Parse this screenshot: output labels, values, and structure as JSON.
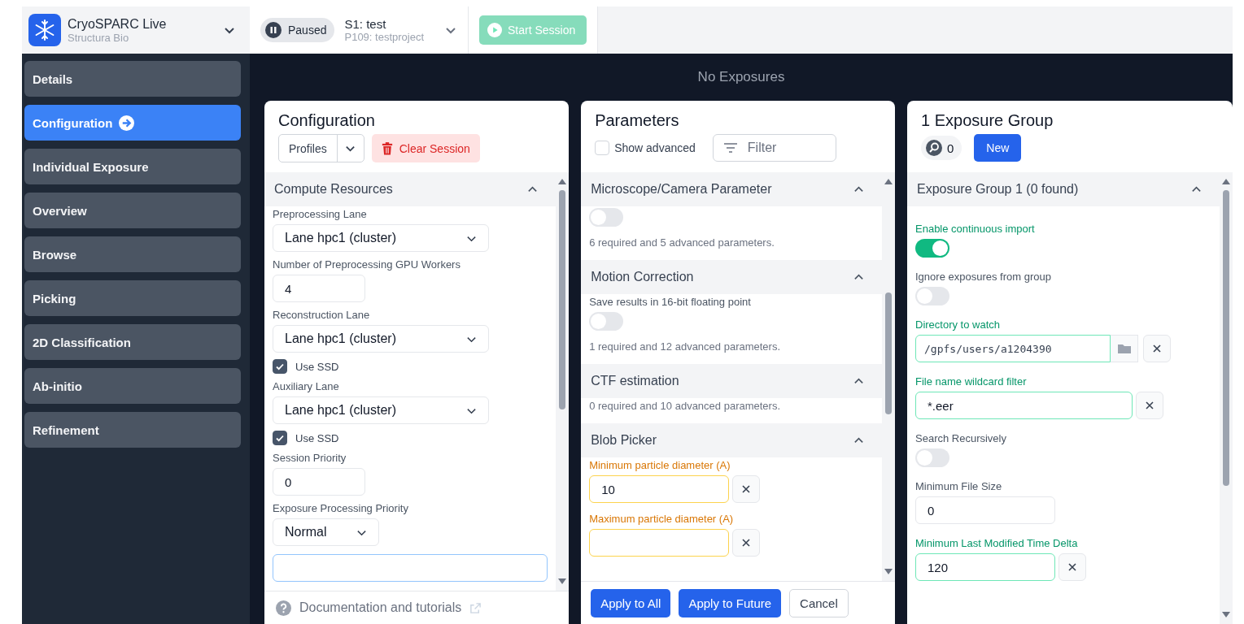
{
  "header": {
    "app_name": "CryoSPARC Live",
    "org": "Structura Bio",
    "status": "Paused",
    "session": "S1: test",
    "project": "P109: testproject",
    "start_button": {
      "label": "Start Session",
      "disabled": true
    }
  },
  "sidebar": {
    "items": [
      {
        "label": "Details",
        "selected": false
      },
      {
        "label": "Configuration",
        "selected": true
      },
      {
        "label": "Individual Exposure",
        "selected": false
      },
      {
        "label": "Overview",
        "selected": false
      },
      {
        "label": "Browse",
        "selected": false
      },
      {
        "label": "Picking",
        "selected": false
      },
      {
        "label": "2D Classification",
        "selected": false
      },
      {
        "label": "Ab-initio",
        "selected": false
      },
      {
        "label": "Refinement",
        "selected": false
      }
    ]
  },
  "banner": "No Exposures",
  "configuration": {
    "title": "Configuration",
    "profiles_button": "Profiles",
    "clear_button": "Clear Session",
    "section": {
      "title": "Compute Resources",
      "expanded": true,
      "fields": [
        {
          "kind": "select",
          "label": "Preprocessing Lane",
          "value": "Lane hpc1 (cluster)"
        },
        {
          "kind": "number",
          "label": "Number of Preprocessing GPU Workers",
          "value": "4"
        },
        {
          "kind": "select",
          "label": "Reconstruction Lane",
          "value": "Lane hpc1 (cluster)"
        },
        {
          "kind": "checkbox",
          "label": "Use SSD",
          "checked": true
        },
        {
          "kind": "select",
          "label": "Auxiliary Lane",
          "value": "Lane hpc1 (cluster)"
        },
        {
          "kind": "checkbox",
          "label": "Use SSD",
          "checked": true
        },
        {
          "kind": "number",
          "label": "Session Priority",
          "value": "0"
        },
        {
          "kind": "short-select",
          "label": "Exposure Processing Priority",
          "value": "Normal"
        },
        {
          "kind": "empty-field"
        }
      ]
    },
    "footer_link": "Documentation and tutorials"
  },
  "parameters": {
    "title": "Parameters",
    "show_advanced": {
      "label": "Show advanced",
      "checked": false
    },
    "filter": {
      "placeholder": "Filter"
    },
    "sections": [
      {
        "title": "Microscope/Camera Parameter",
        "expanded": true,
        "fields": [
          {
            "kind": "toggle",
            "on": false
          }
        ],
        "summary": "6 required and 5 advanced parameters."
      },
      {
        "title": "Motion Correction",
        "expanded": true,
        "fields": [
          {
            "kind": "toggle",
            "label": "Save results in 16-bit floating point",
            "on": false
          }
        ],
        "summary": "1 required and 12 advanced parameters."
      },
      {
        "title": "CTF estimation",
        "expanded": true,
        "summary": "0 required and 10 advanced parameters."
      },
      {
        "title": "Blob Picker",
        "expanded": true,
        "fields": [
          {
            "kind": "text",
            "label": "Minimum particle diameter (A)",
            "value": "10",
            "modified": true,
            "clearable": true
          },
          {
            "kind": "text",
            "label": "Maximum particle diameter (A)",
            "modified": true,
            "clearable": true
          }
        ]
      }
    ],
    "buttons": [
      {
        "label": "Apply to All",
        "primary": true
      },
      {
        "label": "Apply to Future",
        "primary": true
      },
      {
        "label": "Cancel",
        "primary": false
      }
    ]
  },
  "exposure_groups": {
    "title": "1 Exposure Group",
    "found_count": "0",
    "new_button": "New",
    "section": {
      "title": "Exposure Group 1 (0 found)",
      "expanded": true,
      "fields": [
        {
          "kind": "toggle",
          "label": "Enable continuous import",
          "on": true,
          "valid": true
        },
        {
          "kind": "toggle",
          "label": "Ignore exposures from group",
          "on": false
        },
        {
          "kind": "path",
          "label": "Directory to watch",
          "value": "/gpfs/users/a1204390",
          "valid": true,
          "clearable": true
        },
        {
          "kind": "text",
          "label": "File name wildcard filter",
          "value": "*.eer",
          "valid": true,
          "clearable": true
        },
        {
          "kind": "toggle",
          "label": "Search Recursively",
          "on": false
        },
        {
          "kind": "number",
          "label": "Minimum File Size",
          "value": "0"
        },
        {
          "kind": "text",
          "label": "Minimum Last Modified Time Delta",
          "value": "120",
          "valid": true,
          "clearable": true
        }
      ]
    }
  }
}
